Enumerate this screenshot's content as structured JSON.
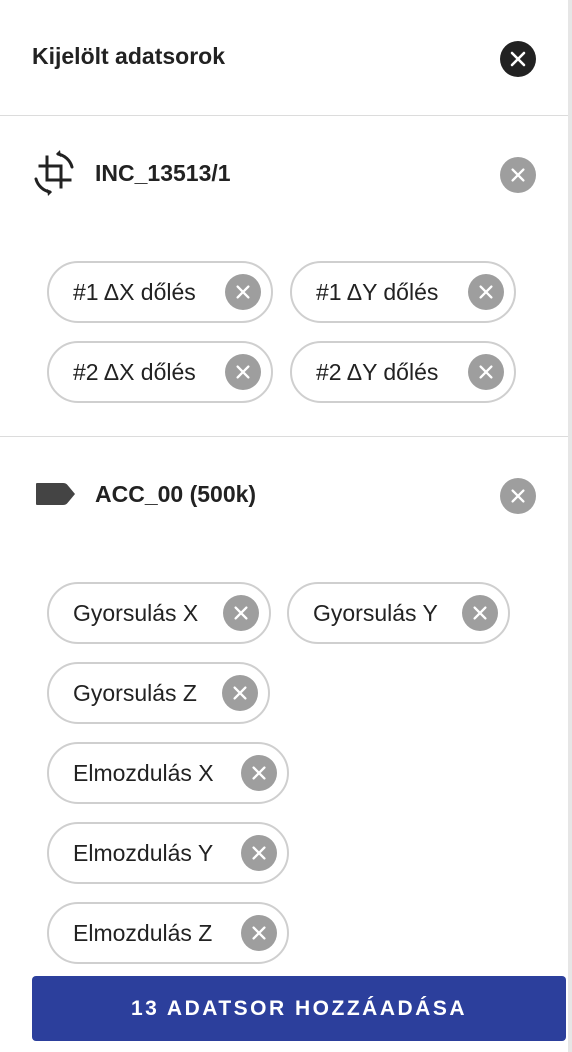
{
  "header": {
    "title": "Kijelölt adatsorok",
    "close_icon": "close-icon"
  },
  "sections": [
    {
      "title": "INC_13513/1",
      "icon": "crop-rotate-icon",
      "chips": [
        {
          "label": "#1 ΔX dőlés"
        },
        {
          "label": "#1 ΔY dőlés"
        },
        {
          "label": "#2 ΔX dőlés"
        },
        {
          "label": "#2 ΔY dőlés"
        }
      ]
    },
    {
      "title": "ACC_00 (500k)",
      "icon": "label-icon",
      "chips": [
        {
          "label": "Gyorsulás X"
        },
        {
          "label": "Gyorsulás Y"
        },
        {
          "label": "Gyorsulás Z"
        },
        {
          "label": "Elmozdulás X"
        },
        {
          "label": "Elmozdulás Y"
        },
        {
          "label": "Elmozdulás Z"
        }
      ]
    }
  ],
  "footer": {
    "add_button_label": "13 ADATSOR HOZZÁADÁSA"
  },
  "colors": {
    "primary": "#2c3f9c",
    "chip_remove": "#9e9e9e",
    "close_dark": "#222222"
  }
}
